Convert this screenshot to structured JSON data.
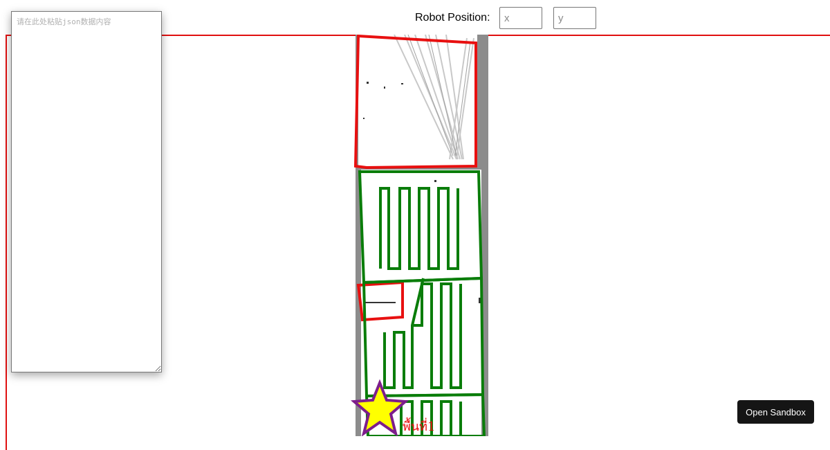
{
  "header": {
    "robot_position_label": "Robot Position:",
    "x_placeholder": "x",
    "y_placeholder": "y",
    "x_value": "",
    "y_value": ""
  },
  "json_editor": {
    "placeholder": "请在此处粘贴json数据内容",
    "value": ""
  },
  "map": {
    "label_text": "พื้นที่1",
    "colors": {
      "occupancy_gray": "#8c8c8c",
      "free_white": "#ffffff",
      "restricted_zone": "#e81010",
      "coverage_path": "#0a7d0a",
      "robot_star_fill": "#ffff00",
      "robot_star_stroke": "#7d1e8c",
      "frame_border": "#e01010"
    }
  },
  "sandbox_button": {
    "label": "Open Sandbox"
  }
}
